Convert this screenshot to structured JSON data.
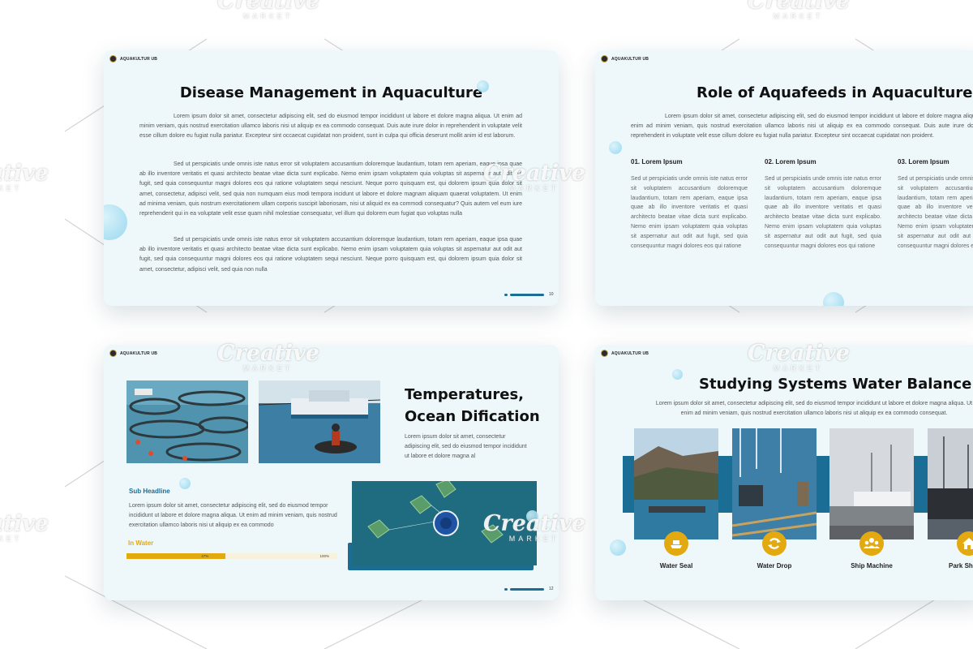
{
  "brand": "AQUAKULTUR UB",
  "slide1": {
    "title": "Disease Management in Aquaculture",
    "paragraphs": [
      "Lorem ipsum dolor sit amet, consectetur adipiscing elit, sed do eiusmod tempor incididunt ut labore et dolore magna aliqua. Ut enim ad minim veniam, quis nostrud exercitation ullamco laboris nisi ut aliquip ex ea commodo consequat. Duis aute irure dolor in reprehenderit in voluptate velit esse cillum dolore eu fugiat nulla pariatur. Excepteur sint occaecat cupidatat non proident, sunt in culpa qui officia deserunt mollit anim id est laborum.",
      "Sed ut perspiciatis unde omnis iste natus error sit voluptatem accusantium doloremque laudantium, totam rem aperiam, eaque ipsa quae ab illo inventore veritatis et quasi architecto beatae vitae dicta sunt explicabo. Nemo enim ipsam voluptatem quia voluptas sit aspernatur aut odit aut fugit, sed quia consequuntur magni dolores eos qui ratione voluptatem sequi nesciunt. Neque porro quisquam est, qui dolorem ipsum quia dolor sit amet, consectetur, adipisci velit, sed quia non numquam eius modi tempora incidunt ut labore et dolore magnam aliquam quaerat voluptatem. Ut enim ad minima veniam, quis nostrum exercitationem ullam corporis suscipit laboriosam, nisi ut aliquid ex ea commodi consequatur? Quis autem vel eum iure reprehenderit qui in ea voluptate velit esse quam nihil molestiae consequatur, vel illum qui dolorem eum fugiat quo voluptas nulla",
      "Sed ut perspiciatis unde omnis iste natus error sit voluptatem accusantium doloremque laudantium, totam rem aperiam, eaque ipsa quae ab illo inventore veritatis et quasi architecto beatae vitae dicta sunt explicabo. Nemo enim ipsam voluptatem quia voluptas sit aspernatur aut odit aut fugit, sed quia consequuntur magni dolores eos qui ratione voluptatem sequi nesciunt. Neque porro quisquam est, qui dolorem ipsum quia dolor sit amet, consectetur, adipisci velit, sed quia non nulla"
    ],
    "page": "10"
  },
  "slide2": {
    "title": "Role of Aquafeeds in Aquaculture",
    "intro": "Lorem ipsum dolor sit amet, consectetur adipiscing elit, sed do eiusmod tempor incididunt ut labore et dolore magna aliqua. Ut enim ad minim veniam, quis nostrud exercitation ullamco laboris nisi ut aliquip ex ea commodo consequat. Duis aute irure dolor in reprehenderit in voluptate velit esse cillum dolore eu fugiat nulla pariatur. Excepteur sint occaecat cupidatat non proident.",
    "columns": [
      {
        "heading": "01. Lorem Ipsum",
        "text": "Sed ut perspiciatis unde omnis iste natus error sit voluptatem accusantium doloremque laudantium, totam rem aperiam, eaque ipsa quae ab illo inventore veritatis et quasi architecto beatae vitae dicta sunt explicabo. Nemo enim ipsam voluptatem quia voluptas sit aspernatur aut odit aut fugit, sed quia consequuntur magni dolores eos qui ratione"
      },
      {
        "heading": "02. Lorem Ipsum",
        "text": "Sed ut perspiciatis unde omnis iste natus error sit voluptatem accusantium doloremque laudantium, totam rem aperiam, eaque ipsa quae ab illo inventore veritatis et quasi architecto beatae vitae dicta sunt explicabo. Nemo enim ipsam voluptatem quia voluptas sit aspernatur aut odit aut fugit, sed quia consequuntur magni dolores eos qui ratione"
      },
      {
        "heading": "03. Lorem Ipsum",
        "text": "Sed ut perspiciatis unde omnis iste natus error sit voluptatem accusantium doloremque laudantium, totam rem aperiam, eaque ipsa quae ab illo inventore veritatis et quasi architecto beatae vitae dicta sunt explicabo. Nemo enim ipsam voluptatem quia voluptas sit aspernatur aut odit aut fugit, sed quia consequuntur magni dolores eos qui ratione"
      }
    ]
  },
  "slide3": {
    "title_line1": "Temperatures,",
    "title_line2": "Ocean Dification",
    "body": "Lorem ipsum dolor sit amet, consectetur adipiscing elit, sed do eiusmod tempor incididunt ut labore et dolore magna al",
    "sub_headline": "Sub Headline",
    "sub_text": "Lorem ipsum dolor sit amet, consectetur adipiscing elit, sed do eiusmod tempor incididunt ut labore et dolore magna aliqua. Ut enim ad minim veniam, quis nostrud exercitation ullamco laboris nisi ut aliquip ex ea commodo",
    "in_water_label": "In Water",
    "progress_value_label": "47%",
    "progress_max_label": "100%",
    "progress_fraction": 0.47,
    "page": "12"
  },
  "slide4": {
    "title": "Studying Systems Water Balance",
    "intro": "Lorem ipsum dolor sit amet, consectetur adipiscing elit, sed do eiusmod tempor incididunt ut labore et dolore magna aliqua. Ut enim ad minim veniam, quis nostrud exercitation ullamco laboris nisi ut aliquip ex ea commodo consequat.",
    "items": [
      {
        "label": "Water Seal",
        "icon": "boat-icon"
      },
      {
        "label": "Water Drop",
        "icon": "recycle-icon"
      },
      {
        "label": "Ship Machine",
        "icon": "group-icon"
      },
      {
        "label": "Park Sh",
        "icon": "home-icon"
      }
    ]
  },
  "watermark": {
    "line1": "Creative",
    "line2": "MARKET"
  },
  "colors": {
    "accent_blue": "#1a6e96",
    "accent_gold": "#e2a910",
    "slide_bg": "#eef8fb"
  }
}
